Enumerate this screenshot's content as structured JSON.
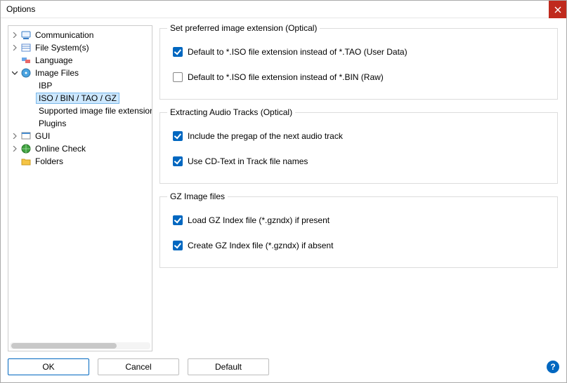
{
  "window": {
    "title": "Options"
  },
  "tree": {
    "items": [
      {
        "label": "Communication",
        "icon": "comm"
      },
      {
        "label": "File System(s)",
        "icon": "fs"
      },
      {
        "label": "Language",
        "icon": "lang"
      },
      {
        "label": "Image Files",
        "icon": "img",
        "expanded": true
      },
      {
        "label": "IBP"
      },
      {
        "label": "ISO / BIN / TAO / GZ",
        "selected": true
      },
      {
        "label": "Supported image file extension"
      },
      {
        "label": "Plugins"
      },
      {
        "label": "GUI",
        "icon": "gui"
      },
      {
        "label": "Online Check",
        "icon": "online"
      },
      {
        "label": "Folders",
        "icon": "folder"
      }
    ]
  },
  "groups": {
    "g1": {
      "title": "Set preferred image extension (Optical)",
      "c1": {
        "label": "Default to *.ISO file extension instead of *.TAO (User Data)",
        "checked": true
      },
      "c2": {
        "label": "Default to *.ISO file extension instead of *.BIN (Raw)",
        "checked": false
      }
    },
    "g2": {
      "title": "Extracting Audio Tracks (Optical)",
      "c1": {
        "label": "Include the pregap of the next audio track",
        "checked": true
      },
      "c2": {
        "label": "Use CD-Text in Track file names",
        "checked": true
      }
    },
    "g3": {
      "title": "GZ Image files",
      "c1": {
        "label": "Load GZ Index file (*.gzndx) if present",
        "checked": true
      },
      "c2": {
        "label": "Create GZ Index file (*.gzndx) if absent",
        "checked": true
      }
    }
  },
  "buttons": {
    "ok": "OK",
    "cancel": "Cancel",
    "default": "Default"
  }
}
